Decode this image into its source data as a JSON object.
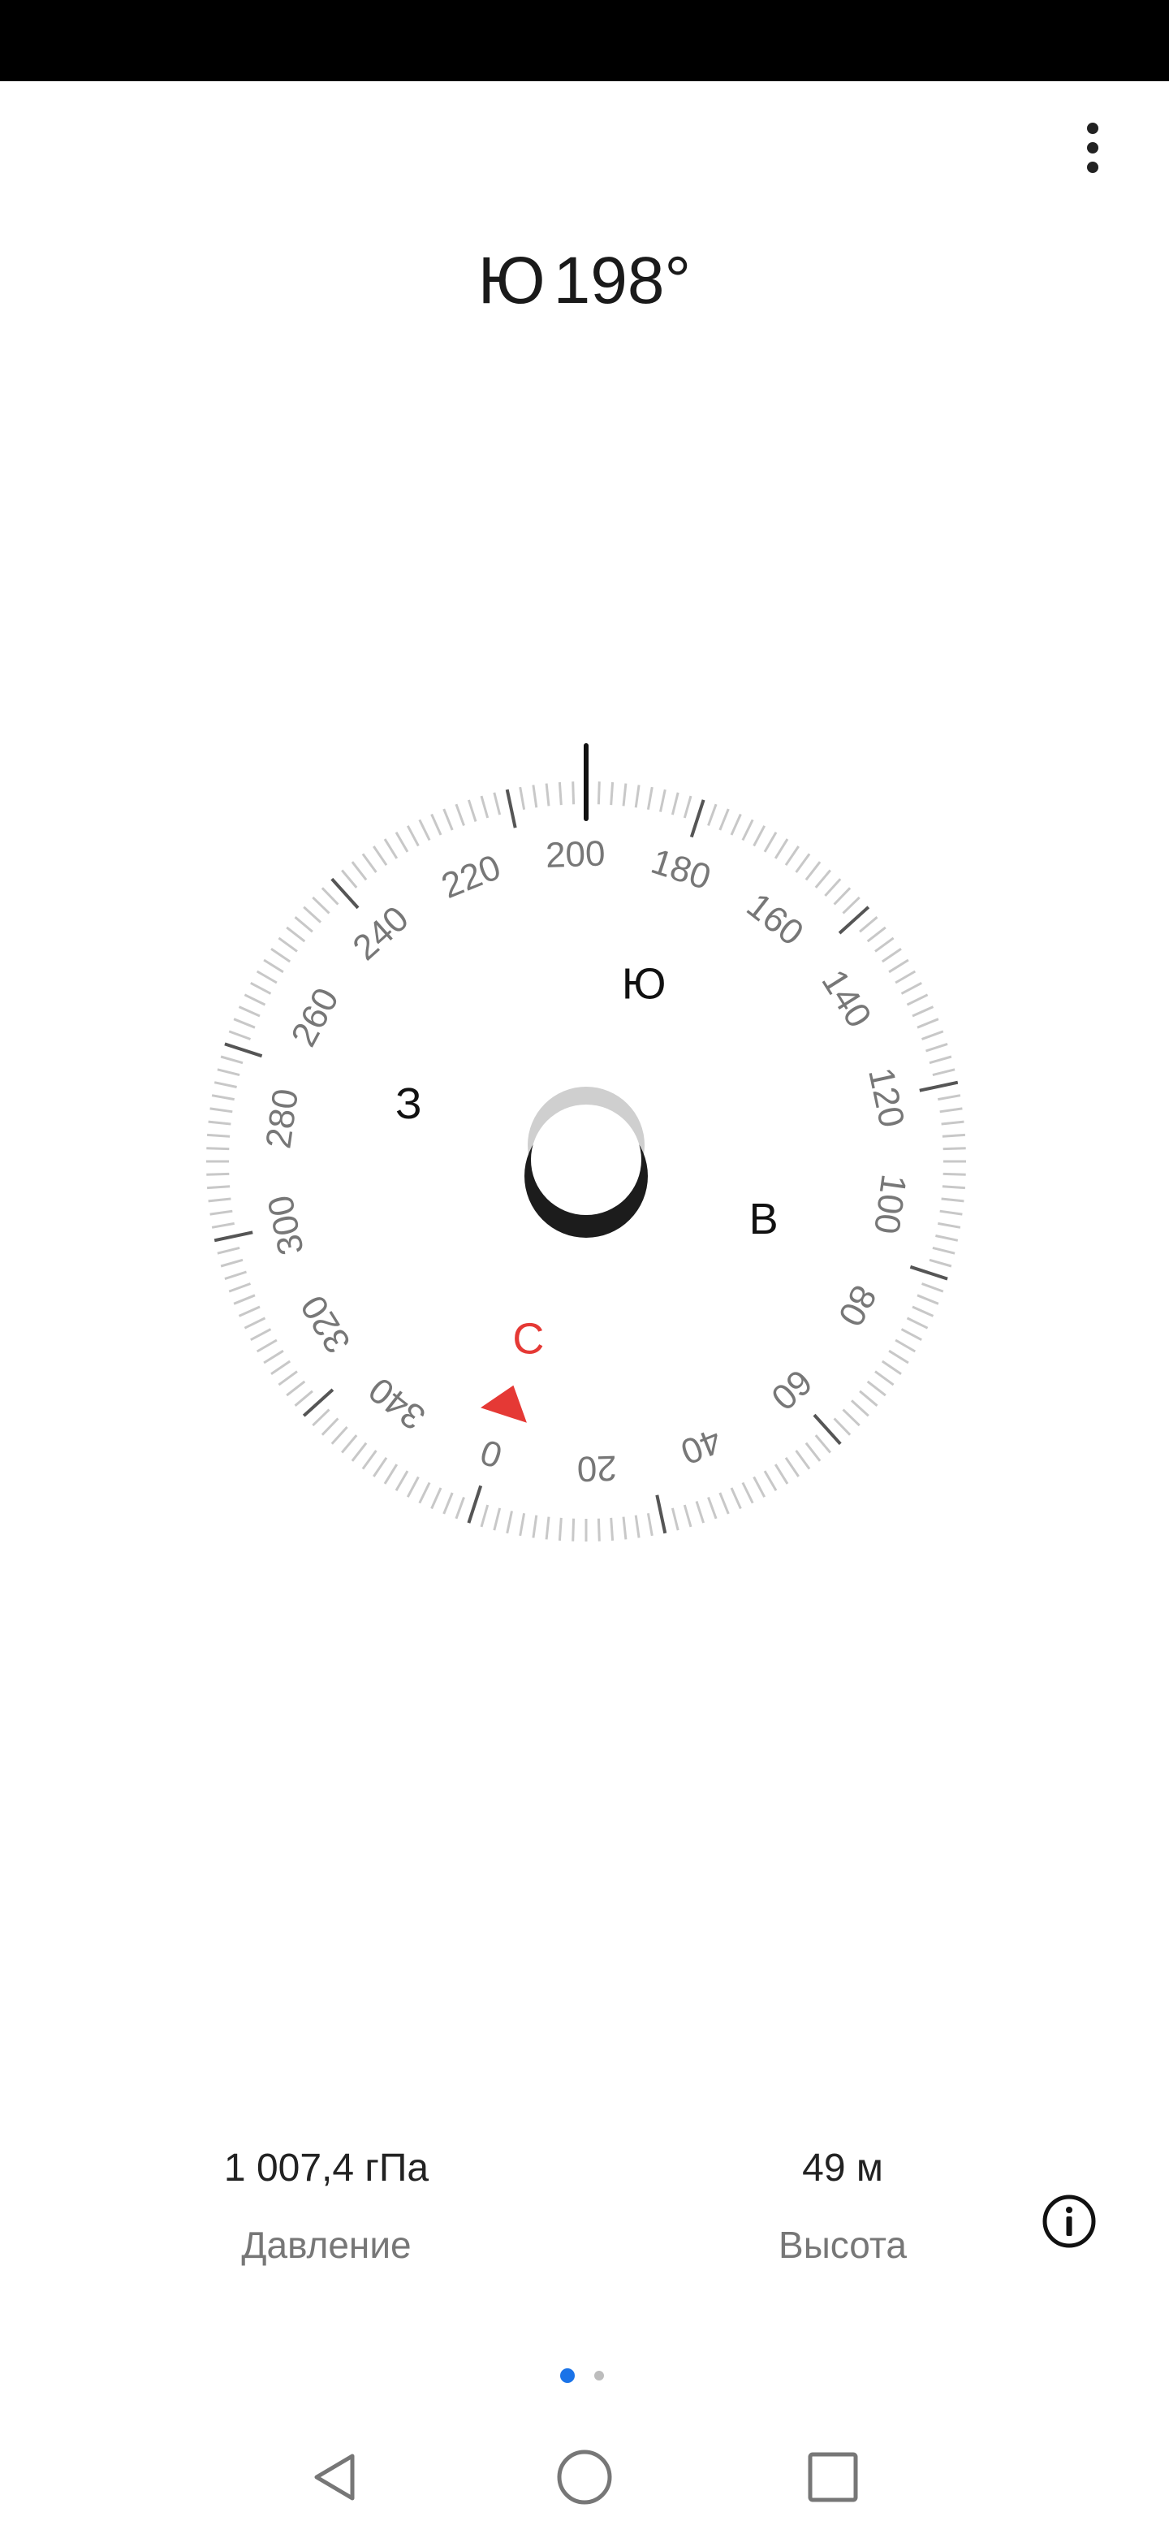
{
  "status_bar": {},
  "heading": {
    "direction": "Ю",
    "degrees": "198°"
  },
  "compass": {
    "heading_deg": 198,
    "tick_labels": [
      "0",
      "20",
      "40",
      "60",
      "80",
      "100",
      "120",
      "140",
      "160",
      "180",
      "200",
      "220",
      "240",
      "260",
      "280",
      "300",
      "320",
      "340"
    ],
    "cardinals": {
      "north": "С",
      "east": "В",
      "south": "Ю",
      "west": "З"
    },
    "colors": {
      "north": "#e53935",
      "tick": "#c8c8c8",
      "major_tick": "#555555",
      "label": "#777777",
      "cardinal": "#111111"
    }
  },
  "stats": {
    "pressure": {
      "value": "1 007,4 гПа",
      "label": "Давление"
    },
    "altitude": {
      "value": "49 м",
      "label": "Высота"
    }
  },
  "icons": {
    "menu": "more-vert-icon",
    "info": "info-icon",
    "back": "nav-back-icon",
    "home": "nav-home-icon",
    "recent": "nav-recent-icon"
  },
  "pager": {
    "pages": 2,
    "active": 1
  }
}
